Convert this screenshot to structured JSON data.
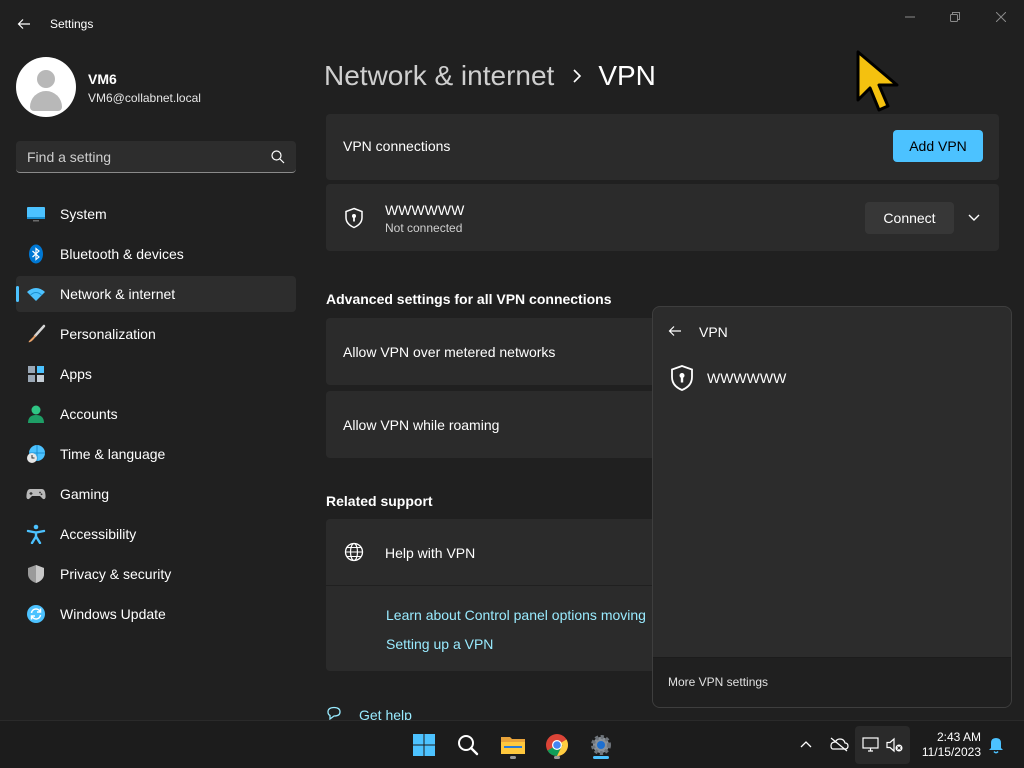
{
  "window": {
    "title": "Settings"
  },
  "user": {
    "name": "VM6",
    "email": "VM6@collabnet.local"
  },
  "search": {
    "placeholder": "Find a setting"
  },
  "sidebar": {
    "items": [
      {
        "label": "System",
        "icon": "system-icon",
        "color": "#4cc2ff"
      },
      {
        "label": "Bluetooth & devices",
        "icon": "bluetooth-icon",
        "color": "#0078d4"
      },
      {
        "label": "Network & internet",
        "icon": "wifi-icon",
        "color": "#4cc2ff",
        "active": true
      },
      {
        "label": "Personalization",
        "icon": "brush-icon",
        "color": "#e8a26a"
      },
      {
        "label": "Apps",
        "icon": "apps-icon",
        "color": "#9aa7b5"
      },
      {
        "label": "Accounts",
        "icon": "accounts-icon",
        "color": "#2fc584"
      },
      {
        "label": "Time & language",
        "icon": "globe-clock-icon",
        "color": "#4cc2ff"
      },
      {
        "label": "Gaming",
        "icon": "gamepad-icon",
        "color": "#b9b9b9"
      },
      {
        "label": "Accessibility",
        "icon": "accessibility-icon",
        "color": "#4cc2ff"
      },
      {
        "label": "Privacy & security",
        "icon": "shield-icon",
        "color": "#9a9a9a"
      },
      {
        "label": "Windows Update",
        "icon": "update-icon",
        "color": "#4cc2ff"
      }
    ]
  },
  "breadcrumb": {
    "parent": "Network & internet",
    "current": "VPN"
  },
  "vpn": {
    "connections_label": "VPN connections",
    "add_button": "Add VPN",
    "connection": {
      "name": "WWWWWW",
      "status": "Not connected",
      "connect_button": "Connect"
    }
  },
  "advanced": {
    "title": "Advanced settings for all VPN connections",
    "metered": "Allow VPN over metered networks",
    "roaming": "Allow VPN while roaming"
  },
  "support": {
    "title": "Related support",
    "help_title": "Help with VPN",
    "links": [
      "Learn about Control panel options moving",
      "Setting up a VPN"
    ],
    "get_help": "Get help"
  },
  "flyout": {
    "title": "VPN",
    "item": "WWWWWW",
    "footer": "More VPN settings"
  },
  "taskbar": {
    "apps": [
      "start-icon",
      "search-icon",
      "file-explorer-icon",
      "chrome-icon",
      "settings-icon"
    ],
    "time": "2:43 AM",
    "date": "11/15/2023"
  },
  "colors": {
    "accent": "#4cc2ff",
    "background": "#202020",
    "card": "#2b2b2b",
    "link": "#99ebff"
  }
}
